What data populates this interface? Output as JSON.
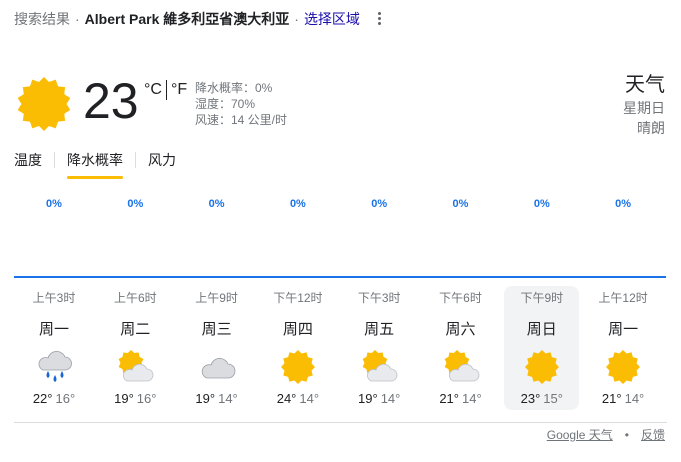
{
  "header": {
    "crumb": "搜索结果",
    "separator": "·",
    "location": "Albert Park 維多利亞省澳大利亚",
    "region_link": "选择区域"
  },
  "current": {
    "icon": "sun-icon",
    "temperature": "23",
    "unit_c": "°C",
    "unit_f": "°F",
    "precip": "降水概率：0%",
    "humidity": "湿度：70%",
    "wind": "风速：14 公里/时"
  },
  "title": {
    "label": "天气",
    "day": "星期日",
    "condition": "晴朗"
  },
  "tabs": [
    "温度",
    "降水概率",
    "风力"
  ],
  "active_tab": 1,
  "precipitation": [
    "0%",
    "0%",
    "0%",
    "0%",
    "0%",
    "0%",
    "0%",
    "0%"
  ],
  "forecast": [
    {
      "time": "上午3时",
      "day": "周一",
      "icon": "rain-cloud-icon",
      "high": "22°",
      "low": "16°"
    },
    {
      "time": "上午6时",
      "day": "周二",
      "icon": "partly-cloudy-icon",
      "high": "19°",
      "low": "16°"
    },
    {
      "time": "上午9时",
      "day": "周三",
      "icon": "cloud-icon",
      "high": "19°",
      "low": "14°"
    },
    {
      "time": "下午12时",
      "day": "周四",
      "icon": "sun-icon",
      "high": "24°",
      "low": "14°"
    },
    {
      "time": "下午3时",
      "day": "周五",
      "icon": "partly-cloudy-icon",
      "high": "19°",
      "low": "14°"
    },
    {
      "time": "下午6时",
      "day": "周六",
      "icon": "partly-cloudy-icon",
      "high": "21°",
      "low": "14°"
    },
    {
      "time": "下午9时",
      "day": "周日",
      "icon": "sun-icon",
      "high": "23°",
      "low": "15°"
    },
    {
      "time": "上午12时",
      "day": "周一",
      "icon": "sun-icon",
      "high": "21°",
      "low": "14°"
    }
  ],
  "selected_day": 6,
  "footer": {
    "source": "Google 天气",
    "dot": "•",
    "feedback": "反馈"
  },
  "colors": {
    "sun": "#fbbc04",
    "accent_blue": "#1a73e8",
    "tab_underline": "#fbbc04",
    "cloud": "#dadce0",
    "rain": "#1967d2"
  }
}
